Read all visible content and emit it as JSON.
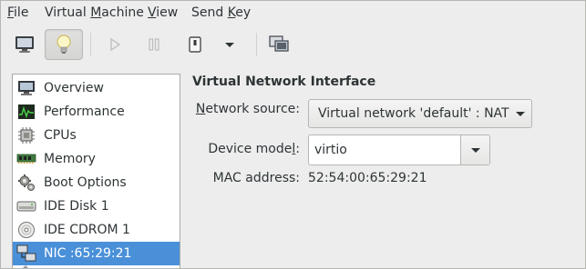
{
  "menubar": {
    "file": {
      "mnemonic": "F",
      "rest": "ile"
    },
    "virtual_machine": {
      "pre": "Virtual ",
      "mnemonic": "M",
      "rest": "achine"
    },
    "view": {
      "mnemonic": "V",
      "rest": "iew"
    },
    "send_key": {
      "pre": "Send ",
      "mnemonic": "K",
      "rest": "ey"
    }
  },
  "toolbar": {
    "icons": [
      "console-icon",
      "details-lightbulb-icon",
      "run-icon",
      "pause-icon",
      "shutdown-icon",
      "shutdown-menu-icon",
      "fullscreen-icon"
    ],
    "active": "details-lightbulb-icon"
  },
  "sidebar": {
    "items": [
      {
        "label": "Overview",
        "icon": "monitor-icon"
      },
      {
        "label": "Performance",
        "icon": "performance-graph-icon"
      },
      {
        "label": "CPUs",
        "icon": "cpu-chip-icon"
      },
      {
        "label": "Memory",
        "icon": "memory-module-icon"
      },
      {
        "label": "Boot Options",
        "icon": "boot-gear-icon"
      },
      {
        "label": "IDE Disk 1",
        "icon": "hard-disk-icon"
      },
      {
        "label": "IDE CDROM 1",
        "icon": "cdrom-icon"
      },
      {
        "label": "NIC :65:29:21",
        "icon": "network-icon"
      }
    ],
    "selected_index": 7
  },
  "main": {
    "title": "Virtual Network Interface",
    "network_source": {
      "label_mnemonic": "N",
      "label_rest": "etwork source:",
      "value": "Virtual network 'default' : NAT"
    },
    "device_model": {
      "label_pre": "Device mode",
      "label_mnemonic": "l",
      "label_post": ":",
      "value": "virtio"
    },
    "mac_address": {
      "label": "MAC address:",
      "value": "52:54:00:65:29:21"
    }
  },
  "colors": {
    "window_bg": "#ededed",
    "selection": "#4a90d9",
    "text": "#2e3436"
  }
}
